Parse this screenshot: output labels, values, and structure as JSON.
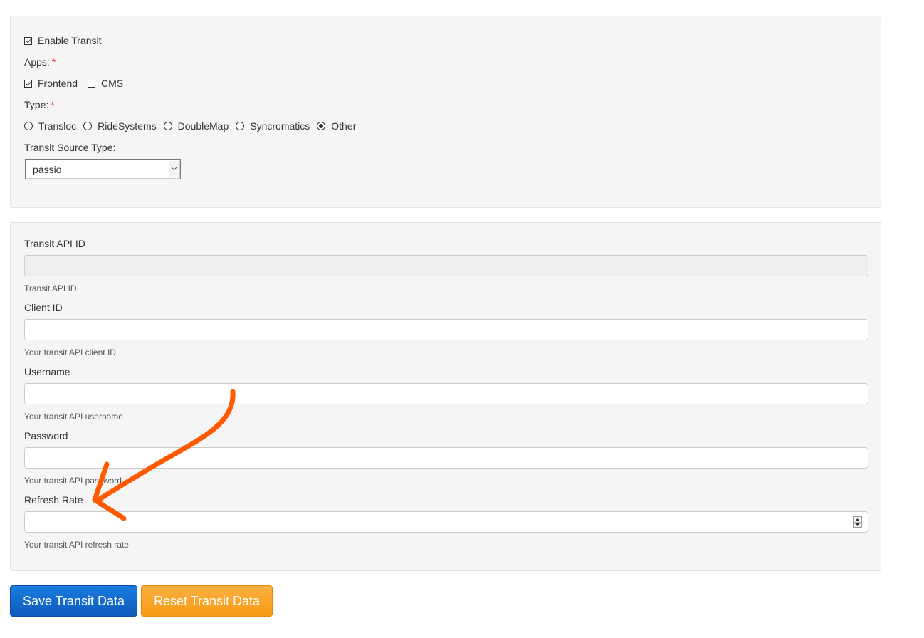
{
  "settings": {
    "enable_transit_label": "Enable Transit",
    "enable_transit_checked": true,
    "apps_label": "Apps:",
    "required_mark": "*",
    "apps": [
      {
        "label": "Frontend",
        "checked": true
      },
      {
        "label": "CMS",
        "checked": false
      }
    ],
    "type_label": "Type:",
    "types": [
      {
        "label": "Transloc",
        "selected": false
      },
      {
        "label": "RideSystems",
        "selected": false
      },
      {
        "label": "DoubleMap",
        "selected": false
      },
      {
        "label": "Syncromatics",
        "selected": false
      },
      {
        "label": "Other",
        "selected": true
      }
    ],
    "source_type_label": "Transit Source Type:",
    "source_type_value": "passio"
  },
  "fields": {
    "api_id": {
      "label": "Transit API ID",
      "value": "",
      "help": "Transit API ID",
      "disabled": true
    },
    "client_id": {
      "label": "Client ID",
      "value": "",
      "help": "Your transit API client ID"
    },
    "username": {
      "label": "Username",
      "value": "",
      "help": "Your transit API username"
    },
    "password": {
      "label": "Password",
      "value": "",
      "help": "Your transit API password"
    },
    "refresh_rate": {
      "label": "Refresh Rate",
      "value": "",
      "help": "Your transit API refresh rate"
    }
  },
  "actions": {
    "save_label": "Save Transit Data",
    "reset_label": "Reset Transit Data"
  },
  "colors": {
    "save_button": "#1a6fd6",
    "reset_button": "#f7a42a",
    "annotation_arrow": "#ff5a00",
    "required_mark": "#e33333"
  }
}
